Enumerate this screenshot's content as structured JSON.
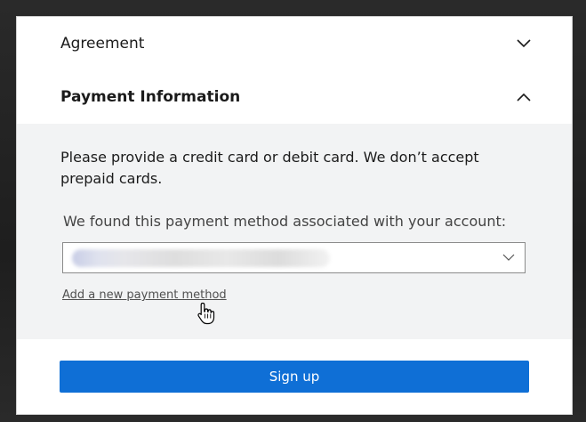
{
  "accordion": {
    "agreement": {
      "title": "Agreement",
      "state": "collapsed"
    },
    "payment": {
      "title": "Payment Information",
      "state": "expanded",
      "description": "Please provide a credit card or debit card. We don’t accept prepaid cards.",
      "found_label": "We found this payment method associated with your account:",
      "selected_method": "",
      "add_link": "Add a new payment method"
    }
  },
  "actions": {
    "signup_label": "Sign up"
  },
  "colors": {
    "accent": "#0f6fd6",
    "content_bg": "#f2f3f4",
    "frame": "#1e1e1e"
  },
  "icons": {
    "agreement_chevron": "chevron-down-icon",
    "payment_chevron": "chevron-up-icon",
    "select_chevron": "chevron-down-icon",
    "cursor": "hand-pointer-icon"
  }
}
